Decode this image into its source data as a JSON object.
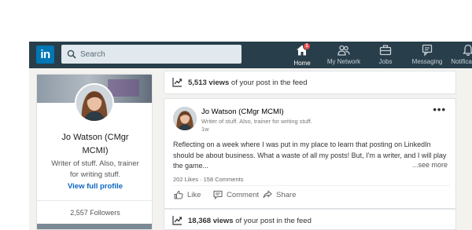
{
  "nav": {
    "logo": "in",
    "search_placeholder": "Search",
    "items": [
      {
        "label": "Home",
        "icon": "home-icon",
        "badge": "1"
      },
      {
        "label": "My Network",
        "icon": "network-icon"
      },
      {
        "label": "Jobs",
        "icon": "briefcase-icon"
      },
      {
        "label": "Messaging",
        "icon": "messaging-icon"
      },
      {
        "label": "Notifications",
        "icon": "bell-icon"
      }
    ]
  },
  "profile": {
    "name": "Jo Watson (CMgr MCMI)",
    "headline": "Writer of stuff. Also, trainer for writing stuff.",
    "view_profile": "View full profile",
    "followers": "2,557 Followers"
  },
  "feed": {
    "top_views": {
      "count": "5,513 views",
      "suffix": " of your post in the feed"
    },
    "post": {
      "author": "Jo Watson (CMgr MCMI)",
      "headline": "Writer of stuff. Also, trainer for writing stuff.",
      "time": "1w",
      "text": "Reflecting on a week where I was put in my place to learn that posting on LinkedIn should be about business. What a waste of all my posts! But, I'm a writer, and I will play the game...",
      "see_more": "...see more",
      "likes": "202 Likes",
      "comments": "158 Comments",
      "actions": {
        "like": "Like",
        "comment": "Comment",
        "share": "Share"
      }
    },
    "bottom_views": {
      "count": "18,368 views",
      "suffix": " of your post in the feed"
    }
  },
  "colors": {
    "nav_bg": "#283e4a",
    "brand": "#0077b5",
    "link": "#0a66c2",
    "badge": "#e34c4c"
  }
}
